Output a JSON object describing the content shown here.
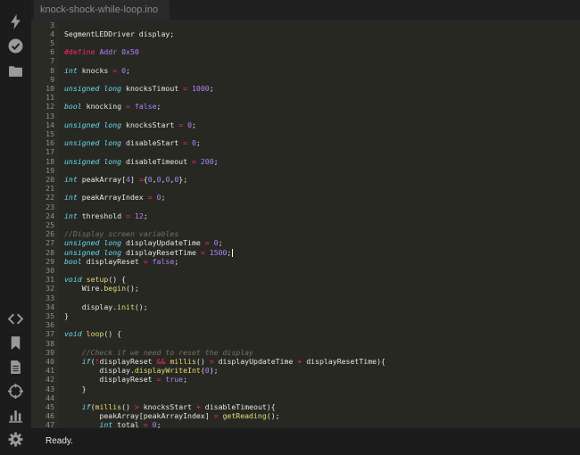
{
  "colors": {
    "default": "#e6e6e6",
    "keyword": "#66d9ef",
    "number": "#ae81ff",
    "macro": "#f92672",
    "operator": "#f92672",
    "function": "#e6db74",
    "comment": "#75715e",
    "bool": "#ae81ff"
  },
  "sidebar": {
    "top_icons": [
      "lightning-icon",
      "check-circle-icon",
      "folder-icon"
    ],
    "bottom_icons": [
      "code-icon",
      "bookmark-icon",
      "document-icon",
      "crosshair-icon",
      "chart-icon",
      "gear-icon"
    ]
  },
  "tab": {
    "label": "knock-shock-while-loop.ino"
  },
  "status": {
    "text": "Ready."
  },
  "editor": {
    "lines": [
      {
        "n": "3",
        "t": []
      },
      {
        "n": "4",
        "t": [
          [
            "SegmentLEDDriver display;",
            "default"
          ]
        ]
      },
      {
        "n": "5",
        "t": []
      },
      {
        "n": "6",
        "t": [
          [
            "#define",
            "macro"
          ],
          [
            " ",
            "default"
          ],
          [
            "Addr 0x50",
            "number"
          ]
        ]
      },
      {
        "n": "7",
        "t": []
      },
      {
        "n": "8",
        "t": [
          [
            "int",
            "keyword"
          ],
          [
            " knocks ",
            "default"
          ],
          [
            "=",
            "operator"
          ],
          [
            " ",
            "default"
          ],
          [
            "0",
            "number"
          ],
          [
            ";",
            "default"
          ]
        ]
      },
      {
        "n": "9",
        "t": []
      },
      {
        "n": "10",
        "t": [
          [
            "unsigned long",
            "keyword"
          ],
          [
            " knocksTimout ",
            "default"
          ],
          [
            "=",
            "operator"
          ],
          [
            " ",
            "default"
          ],
          [
            "1000",
            "number"
          ],
          [
            ";",
            "default"
          ]
        ]
      },
      {
        "n": "11",
        "t": []
      },
      {
        "n": "12",
        "t": [
          [
            "bool",
            "keyword"
          ],
          [
            " knocking ",
            "default"
          ],
          [
            "=",
            "operator"
          ],
          [
            " ",
            "default"
          ],
          [
            "false",
            "bool"
          ],
          [
            ";",
            "default"
          ]
        ]
      },
      {
        "n": "13",
        "t": []
      },
      {
        "n": "14",
        "t": [
          [
            "unsigned long",
            "keyword"
          ],
          [
            " knocksStart ",
            "default"
          ],
          [
            "=",
            "operator"
          ],
          [
            " ",
            "default"
          ],
          [
            "0",
            "number"
          ],
          [
            ";",
            "default"
          ]
        ]
      },
      {
        "n": "15",
        "t": []
      },
      {
        "n": "16",
        "t": [
          [
            "unsigned long",
            "keyword"
          ],
          [
            " disableStart ",
            "default"
          ],
          [
            "=",
            "operator"
          ],
          [
            " ",
            "default"
          ],
          [
            "0",
            "number"
          ],
          [
            ";",
            "default"
          ]
        ]
      },
      {
        "n": "17",
        "t": []
      },
      {
        "n": "18",
        "t": [
          [
            "unsigned long",
            "keyword"
          ],
          [
            " disableTimeout ",
            "default"
          ],
          [
            "=",
            "operator"
          ],
          [
            " ",
            "default"
          ],
          [
            "200",
            "number"
          ],
          [
            ";",
            "default"
          ]
        ]
      },
      {
        "n": "19",
        "t": []
      },
      {
        "n": "20",
        "t": [
          [
            "int",
            "keyword"
          ],
          [
            " peakArray[",
            "default"
          ],
          [
            "4",
            "number"
          ],
          [
            "] ",
            "default"
          ],
          [
            "=",
            "operator"
          ],
          [
            "{",
            "default"
          ],
          [
            "0",
            "number"
          ],
          [
            ",",
            "default"
          ],
          [
            "0",
            "number"
          ],
          [
            ",",
            "default"
          ],
          [
            "0",
            "number"
          ],
          [
            ",",
            "default"
          ],
          [
            "0",
            "number"
          ],
          [
            "};",
            "default"
          ]
        ]
      },
      {
        "n": "21",
        "t": []
      },
      {
        "n": "22",
        "t": [
          [
            "int",
            "keyword"
          ],
          [
            " peakArrayIndex ",
            "default"
          ],
          [
            "=",
            "operator"
          ],
          [
            " ",
            "default"
          ],
          [
            "0",
            "number"
          ],
          [
            ";",
            "default"
          ]
        ]
      },
      {
        "n": "23",
        "t": []
      },
      {
        "n": "24",
        "t": [
          [
            "int",
            "keyword"
          ],
          [
            " threshold ",
            "default"
          ],
          [
            "=",
            "operator"
          ],
          [
            " ",
            "default"
          ],
          [
            "12",
            "number"
          ],
          [
            ";",
            "default"
          ]
        ]
      },
      {
        "n": "25",
        "t": []
      },
      {
        "n": "26",
        "t": [
          [
            "//Display screen variables",
            "comment"
          ]
        ]
      },
      {
        "n": "27",
        "t": [
          [
            "unsigned long",
            "keyword"
          ],
          [
            " displayUpdateTime ",
            "default"
          ],
          [
            "=",
            "operator"
          ],
          [
            " ",
            "default"
          ],
          [
            "0",
            "number"
          ],
          [
            ";",
            "default"
          ]
        ]
      },
      {
        "n": "28",
        "t": [
          [
            "unsigned long",
            "keyword"
          ],
          [
            " displayResetTime ",
            "default"
          ],
          [
            "=",
            "operator"
          ],
          [
            " ",
            "default"
          ],
          [
            "1500",
            "number"
          ],
          [
            ";",
            "default"
          ]
        ],
        "cursor": true
      },
      {
        "n": "29",
        "t": [
          [
            "bool",
            "keyword"
          ],
          [
            " displayReset ",
            "default"
          ],
          [
            "=",
            "operator"
          ],
          [
            " ",
            "default"
          ],
          [
            "false",
            "bool"
          ],
          [
            ";",
            "default"
          ]
        ]
      },
      {
        "n": "30",
        "t": []
      },
      {
        "n": "31",
        "t": [
          [
            "void",
            "keyword"
          ],
          [
            " ",
            "default"
          ],
          [
            "setup",
            "function"
          ],
          [
            "() {",
            "default"
          ]
        ]
      },
      {
        "n": "32",
        "t": [
          [
            "    Wire.",
            "default"
          ],
          [
            "begin",
            "function"
          ],
          [
            "();",
            "default"
          ]
        ]
      },
      {
        "n": "33",
        "t": []
      },
      {
        "n": "34",
        "t": [
          [
            "    display.",
            "default"
          ],
          [
            "init",
            "function"
          ],
          [
            "();",
            "default"
          ]
        ]
      },
      {
        "n": "35",
        "t": [
          [
            "}",
            "default"
          ]
        ]
      },
      {
        "n": "36",
        "t": []
      },
      {
        "n": "37",
        "t": [
          [
            "void",
            "keyword"
          ],
          [
            " ",
            "default"
          ],
          [
            "loop",
            "function"
          ],
          [
            "() {",
            "default"
          ]
        ]
      },
      {
        "n": "38",
        "t": []
      },
      {
        "n": "39",
        "t": [
          [
            "    //Check if we need to reset the display",
            "comment"
          ]
        ]
      },
      {
        "n": "40",
        "t": [
          [
            "    ",
            "default"
          ],
          [
            "if",
            "keyword"
          ],
          [
            "(",
            "default"
          ],
          [
            "!",
            "operator"
          ],
          [
            "displayReset ",
            "default"
          ],
          [
            "&&",
            "operator"
          ],
          [
            " ",
            "default"
          ],
          [
            "millis",
            "function"
          ],
          [
            "() ",
            "default"
          ],
          [
            ">",
            "operator"
          ],
          [
            " displayUpdateTime ",
            "default"
          ],
          [
            "+",
            "operator"
          ],
          [
            " displayResetTime){",
            "default"
          ]
        ]
      },
      {
        "n": "41",
        "t": [
          [
            "        display.",
            "default"
          ],
          [
            "displayWriteInt",
            "function"
          ],
          [
            "(",
            "default"
          ],
          [
            "0",
            "number"
          ],
          [
            ");",
            "default"
          ]
        ]
      },
      {
        "n": "42",
        "t": [
          [
            "        displayReset ",
            "default"
          ],
          [
            "=",
            "operator"
          ],
          [
            " ",
            "default"
          ],
          [
            "true",
            "bool"
          ],
          [
            ";",
            "default"
          ]
        ]
      },
      {
        "n": "43",
        "t": [
          [
            "    }",
            "default"
          ]
        ]
      },
      {
        "n": "44",
        "t": []
      },
      {
        "n": "45",
        "t": [
          [
            "    ",
            "default"
          ],
          [
            "if",
            "keyword"
          ],
          [
            "(",
            "default"
          ],
          [
            "millis",
            "function"
          ],
          [
            "() ",
            "default"
          ],
          [
            ">",
            "operator"
          ],
          [
            " knocksStart ",
            "default"
          ],
          [
            "+",
            "operator"
          ],
          [
            " disableTimeout){",
            "default"
          ]
        ]
      },
      {
        "n": "46",
        "t": [
          [
            "        peakArray[peakArrayIndex] ",
            "default"
          ],
          [
            "=",
            "operator"
          ],
          [
            " ",
            "default"
          ],
          [
            "getReading",
            "function"
          ],
          [
            "();",
            "default"
          ]
        ]
      },
      {
        "n": "47",
        "t": [
          [
            "        ",
            "default"
          ],
          [
            "int",
            "keyword"
          ],
          [
            " total ",
            "default"
          ],
          [
            "=",
            "operator"
          ],
          [
            " ",
            "default"
          ],
          [
            "0",
            "number"
          ],
          [
            ";",
            "default"
          ]
        ]
      }
    ]
  }
}
